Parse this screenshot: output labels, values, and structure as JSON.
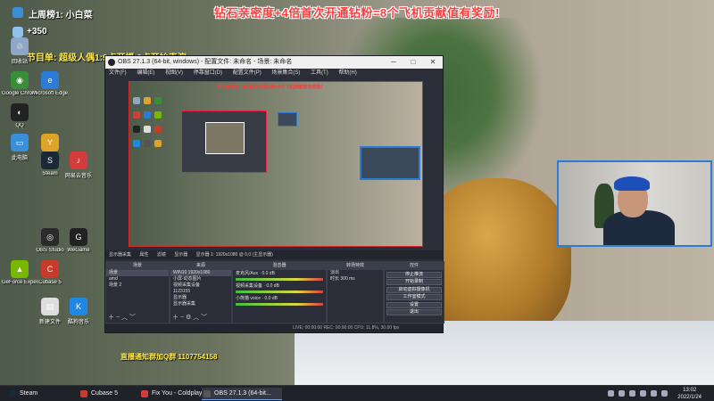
{
  "banner": "钻石亲密度+4倍首次开通钻粉=8个飞机贡献值有奖励!",
  "overlay": {
    "rank": "上周榜1: 小白菜",
    "score": "+350",
    "program": "节目单: 超级人偶1:9点开播 9点开始表演",
    "qq": "直播通知群加Q群 1107754158"
  },
  "desktop_icons": [
    {
      "name": "recycle",
      "label": "回收站",
      "color": "#8fa7c4",
      "glyph": "♲"
    },
    {
      "name": "chrome",
      "label": "Google Chrome",
      "color": "#3a8e3a",
      "glyph": "◉"
    },
    {
      "name": "qq",
      "label": "QQ",
      "color": "#222",
      "glyph": "◐"
    },
    {
      "name": "edge",
      "label": "Microsoft Edge",
      "color": "#2c7bd6",
      "glyph": "e"
    },
    {
      "name": "thispc",
      "label": "此电脑",
      "color": "#3a8fd9",
      "glyph": "▭"
    },
    {
      "name": "app1",
      "label": "YY语音",
      "color": "#e0a32a",
      "glyph": "Y"
    },
    {
      "name": "steam",
      "label": "Steam",
      "color": "#1b2838",
      "glyph": "S"
    },
    {
      "name": "netease",
      "label": "网易云音乐",
      "color": "#d43c3c",
      "glyph": "♪"
    },
    {
      "name": "obs",
      "label": "OBS Studio",
      "color": "#2a2a2a",
      "glyph": "◎"
    },
    {
      "name": "nvidia",
      "label": "GeForce Experience",
      "color": "#76b900",
      "glyph": "▲"
    },
    {
      "name": "cubase",
      "label": "Cubase 5",
      "color": "#c83a2a",
      "glyph": "C"
    },
    {
      "name": "doc1",
      "label": "新建文件",
      "color": "#ddd",
      "glyph": "▤"
    },
    {
      "name": "kugou",
      "label": "酷狗音乐",
      "color": "#1e88e5",
      "glyph": "K"
    },
    {
      "name": "game",
      "label": "WeGame",
      "color": "#222",
      "glyph": "G"
    }
  ],
  "obs": {
    "title": "OBS 27.1.3 (64-bit, windows) - 配置文件: 未命名 - 场景: 未命名",
    "menu": [
      "文件(F)",
      "编辑(E)",
      "视图(V)",
      "停靠窗口(D)",
      "配置文件(P)",
      "场景集合(S)",
      "工具(T)",
      "帮助(H)"
    ],
    "preview_banner": "钻石亲密度+4倍首次开通钻粉=8个飞机贡献值有奖励!",
    "status_bar_top": [
      "显示器采集",
      "属性",
      "滤镜",
      "显示器",
      "显示器 1: 1920x1080 @ 0,0 (主显示器)"
    ],
    "docks": {
      "scenes": {
        "title": "场景",
        "items": [
          "场景",
          "amd",
          "场景 2"
        ],
        "selected": 0
      },
      "sources": {
        "title": "来源",
        "items": [
          "WIN10 1920x1080",
          "小屏-动态图片",
          "视频采集设备",
          "1123155",
          "显示器",
          "显示器采集"
        ]
      },
      "mixer": {
        "title": "混音器",
        "tracks": [
          {
            "name": "麦克风/Aux",
            "db": "0.0 dB"
          },
          {
            "name": "视频采集设备",
            "db": "0.0 dB"
          },
          {
            "name": "小熊猫 voice",
            "db": "0.0 dB"
          }
        ]
      },
      "transitions": {
        "title": "转场特效",
        "type": "淡出",
        "duration_label": "时长",
        "duration": "300 ms"
      },
      "controls": {
        "title": "控件",
        "buttons": [
          "停止推流",
          "开始录制",
          "启动虚拟摄像机",
          "工作室模式",
          "设置",
          "退出"
        ]
      }
    },
    "status_bar_bottom": "LIVE: 00:00:00   REC: 00:00:00   CPU: 11.8%, 30.00 fps"
  },
  "taskbar": {
    "items": [
      {
        "label": "Steam",
        "color": "#1b2838",
        "active": false
      },
      {
        "label": "Cubase 5",
        "color": "#c83a2a",
        "active": false
      },
      {
        "label": "Fix You - Coldplay",
        "color": "#d43c3c",
        "active": false
      },
      {
        "label": "OBS 27.1.3 (64-bit...",
        "color": "#555",
        "active": true
      }
    ],
    "time": "13:02",
    "date": "2022/1/24"
  }
}
